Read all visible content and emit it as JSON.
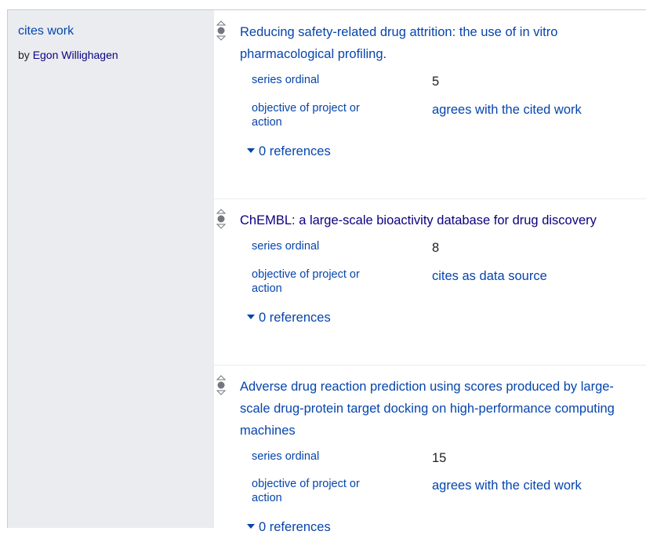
{
  "property": {
    "label": "cites work",
    "by_prefix": "by",
    "author": "Egon Willighagen"
  },
  "statements": [
    {
      "title": "Reducing safety-related drug attrition: the use of in vitro pharmacological profiling.",
      "series_ordinal_label": "series ordinal",
      "series_ordinal": "5",
      "objective_label": "objective of project or action",
      "objective": "agrees with the cited work",
      "references": "0 references"
    },
    {
      "title": "ChEMBL: a large-scale bioactivity database for drug discovery",
      "series_ordinal_label": "series ordinal",
      "series_ordinal": "8",
      "objective_label": "objective of project or action",
      "objective": "cites as data source",
      "references": "0 references"
    },
    {
      "title": "Adverse drug reaction prediction using scores produced by large-scale drug-protein target docking on high-performance computing machines",
      "series_ordinal_label": "series ordinal",
      "series_ordinal": "15",
      "objective_label": "objective of project or action",
      "objective": "agrees with the cited work",
      "references": "0 references"
    }
  ]
}
